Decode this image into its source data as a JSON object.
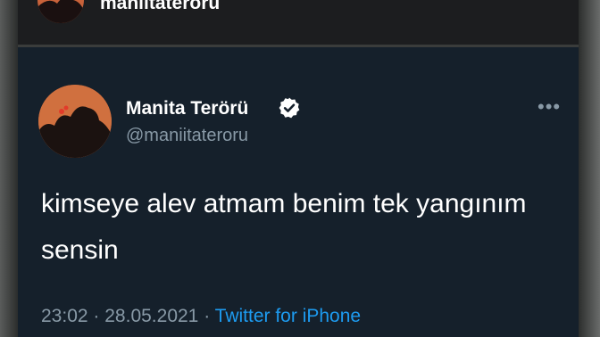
{
  "header": {
    "username": "maniitateroru"
  },
  "tweet": {
    "display_name": "Manita Terörü",
    "handle": "@maniitateroru",
    "verified": true,
    "text": "kimseye alev atmam benim tek yangınım sensin",
    "time": "23:02",
    "separator": "·",
    "date": "28.05.2021",
    "source": "Twitter for iPhone",
    "more_label": "•••"
  },
  "colors": {
    "background": "#15202b",
    "text": "#ffffff",
    "muted": "#8899a6",
    "link": "#1d9bf0",
    "avatar": "#cf6b3f"
  },
  "icons": [
    "verified-badge-icon",
    "more-options-icon"
  ]
}
